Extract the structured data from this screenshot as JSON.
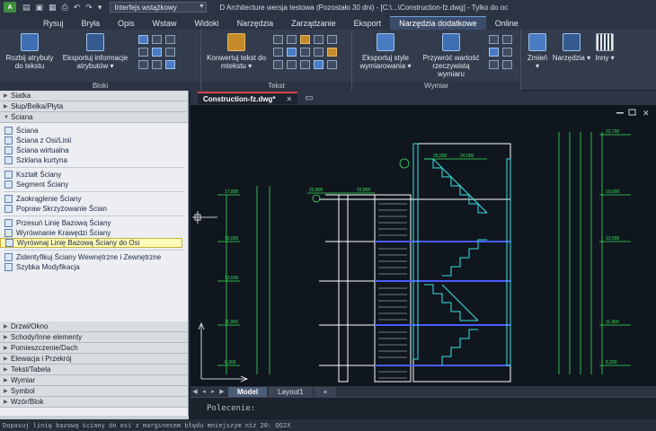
{
  "titlebar": {
    "workspace": "Interfejs wstążkowy",
    "title": "D Architecture wersja testowa (Pozostało 30 dni) - [C:\\...\\Construction-fz.dwg] - Tylko do oc"
  },
  "tabs": [
    "Rysuj",
    "Bryła",
    "Opis",
    "Wstaw",
    "Widoki",
    "Narzędzia",
    "Zarządzanie",
    "Eksport",
    "Narzędzia dodatkowe",
    "Online"
  ],
  "ribbon": {
    "groups": {
      "bloki": "Bloki",
      "tekst": "Tekst",
      "wymiar": "Wymiar"
    },
    "buttons": {
      "rozbij": "Rozbij atrybuty do tekstu",
      "eksportuj_info": "Eksportuj informacje atrybutów ▾",
      "konwertuj": "Konwertuj tekst do mtekstu ▾",
      "eksportuj_style": "Eksportuj style wymiarowania ▾",
      "przywroc": "Przywróć wartość rzeczywistą wymiaru",
      "zmien": "Zmień ▾",
      "narzedzia": "Narzędzia ▾",
      "inny": "Inny ▾"
    }
  },
  "palette": {
    "top_headers": [
      "Siatka",
      "Słup/Belka/Płyta",
      "Ściana"
    ],
    "items_group1": [
      "Ściana",
      "Ściana z Osi/Linii",
      "Ściana wirtualna",
      "Szklana kurtyna"
    ],
    "items_group2": [
      "Kształt Ściany",
      "Segment Ściany"
    ],
    "items_group3": [
      "Zaokrąglenie Ściany",
      "Popraw Skrzyżowanie Ścian"
    ],
    "items_group4": [
      "Przesuń Linię Bazową Ściany",
      "Wyrównanie Krawędzi Ściany",
      "Wyrównaj Linię Bazową Ściany do Osi"
    ],
    "items_group5": [
      "Zidentyfikuj Ściany Wewnętrzne i Zewnętrzne",
      "Szybka Modyfikacja"
    ],
    "bottom_headers": [
      "Drzwi/Okno",
      "Schody/Inne elementy",
      "Pomieszczenie/Dach",
      "Elewacja i Przekrój",
      "Tekst/Tabela",
      "Wymiar",
      "Symbol",
      "Wzór/Blok"
    ]
  },
  "document": {
    "tab": "Construction-fz.dwg*"
  },
  "layouts": [
    "Model",
    "Layout1",
    "+"
  ],
  "command": {
    "prompt": "Polecenie:"
  },
  "status": {
    "text": "Dopasuj linię bazową ściany do osi z marginesem błędu mniejszym niż 20: QQ2X"
  },
  "drawing": {
    "elevations_left": [
      "17,800",
      "15,000",
      "13,500",
      "11,900",
      "8,300"
    ],
    "elevations_right": [
      "22,700",
      "19,000",
      "13,500",
      "11,900",
      "8,300"
    ],
    "top_labels": [
      "22,800",
      "22,800",
      "25,500",
      "24,000"
    ]
  }
}
